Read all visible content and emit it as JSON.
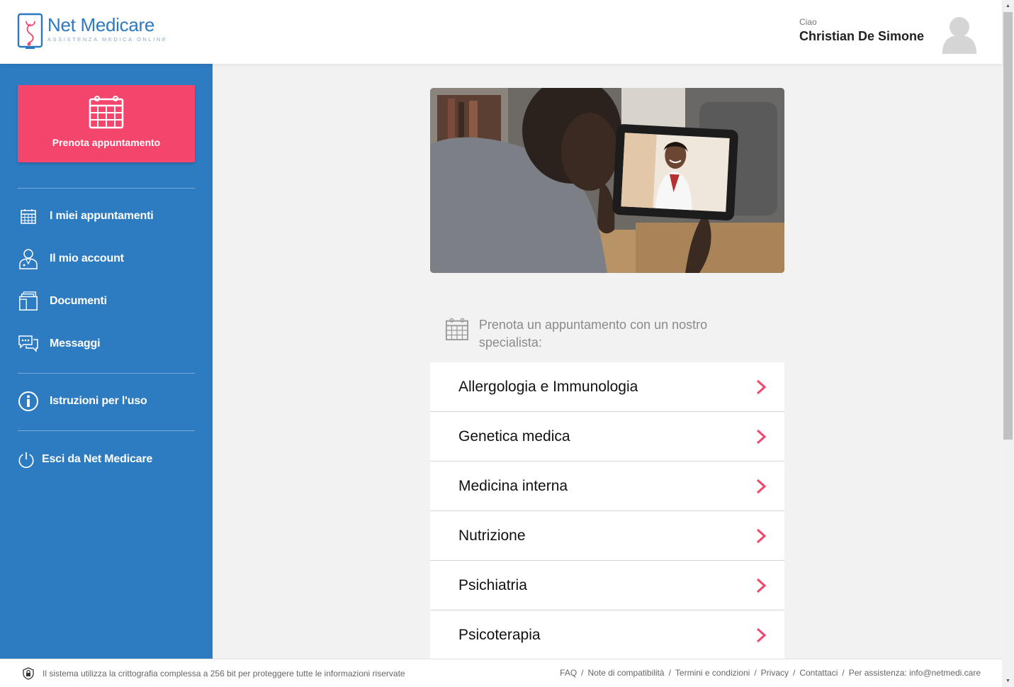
{
  "brand": {
    "title": "Net Medicare",
    "subtitle": "ASSISTENZA MEDICA ONLINE"
  },
  "user": {
    "greeting": "Ciao",
    "name": "Christian De Simone"
  },
  "sidebar": {
    "book_label": "Prenota appuntamento",
    "items": [
      {
        "label": "I miei appuntamenti",
        "icon": "calendar-icon"
      },
      {
        "label": "Il mio account",
        "icon": "user-doctor-icon"
      },
      {
        "label": "Documenti",
        "icon": "documents-icon"
      },
      {
        "label": "Messaggi",
        "icon": "messages-icon"
      },
      {
        "label": "Istruzioni per l'uso",
        "icon": "info-icon"
      },
      {
        "label": "Esci da Net Medicare",
        "icon": "power-icon"
      }
    ]
  },
  "main": {
    "heading": "Prenota un appuntamento con un nostro specialista:",
    "specialties": [
      "Allergologia e Immunologia",
      "Genetica medica",
      "Medicina interna",
      "Nutrizione",
      "Psichiatria",
      "Psicoterapia"
    ]
  },
  "footer": {
    "security_note": "Il sistema utilizza la crittografia complessa a 256 bit per proteggere tutte le informazioni riservate",
    "links": [
      "FAQ",
      "Note di compatibilità",
      "Termini e condizioni",
      "Privacy",
      "Contattaci",
      "Per assistenza: info@netmedi.care"
    ]
  },
  "colors": {
    "brand_blue": "#2d7bc0",
    "accent_pink": "#f4466d"
  }
}
